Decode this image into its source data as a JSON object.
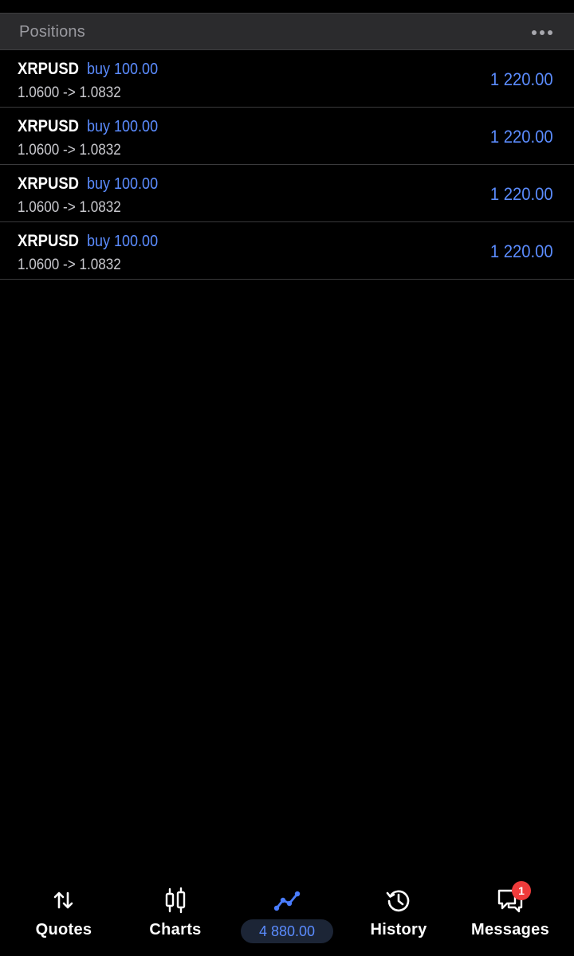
{
  "header": {
    "title": "Positions",
    "more_icon": "more-horizontal-icon"
  },
  "positions": [
    {
      "symbol": "XRPUSD",
      "side_volume": "buy 100.00",
      "prices": "1.0600 -> 1.0832",
      "profit": "1 220.00"
    },
    {
      "symbol": "XRPUSD",
      "side_volume": "buy 100.00",
      "prices": "1.0600 -> 1.0832",
      "profit": "1 220.00"
    },
    {
      "symbol": "XRPUSD",
      "side_volume": "buy 100.00",
      "prices": "1.0600 -> 1.0832",
      "profit": "1 220.00"
    },
    {
      "symbol": "XRPUSD",
      "side_volume": "buy 100.00",
      "prices": "1.0600 -> 1.0832",
      "profit": "1 220.00"
    }
  ],
  "tabbar": {
    "quotes": {
      "label": "Quotes",
      "icon": "arrows-up-down-icon"
    },
    "charts": {
      "label": "Charts",
      "icon": "candlestick-icon"
    },
    "trade": {
      "balance": "4 880.00",
      "icon": "trend-line-icon"
    },
    "history": {
      "label": "History",
      "icon": "history-clock-icon"
    },
    "messages": {
      "label": "Messages",
      "icon": "chat-bubbles-icon",
      "badge": "1"
    }
  },
  "colors": {
    "accent": "#5b8cff",
    "background": "#000000",
    "header_bg": "#2b2b2d",
    "badge": "#ef3b3b"
  }
}
